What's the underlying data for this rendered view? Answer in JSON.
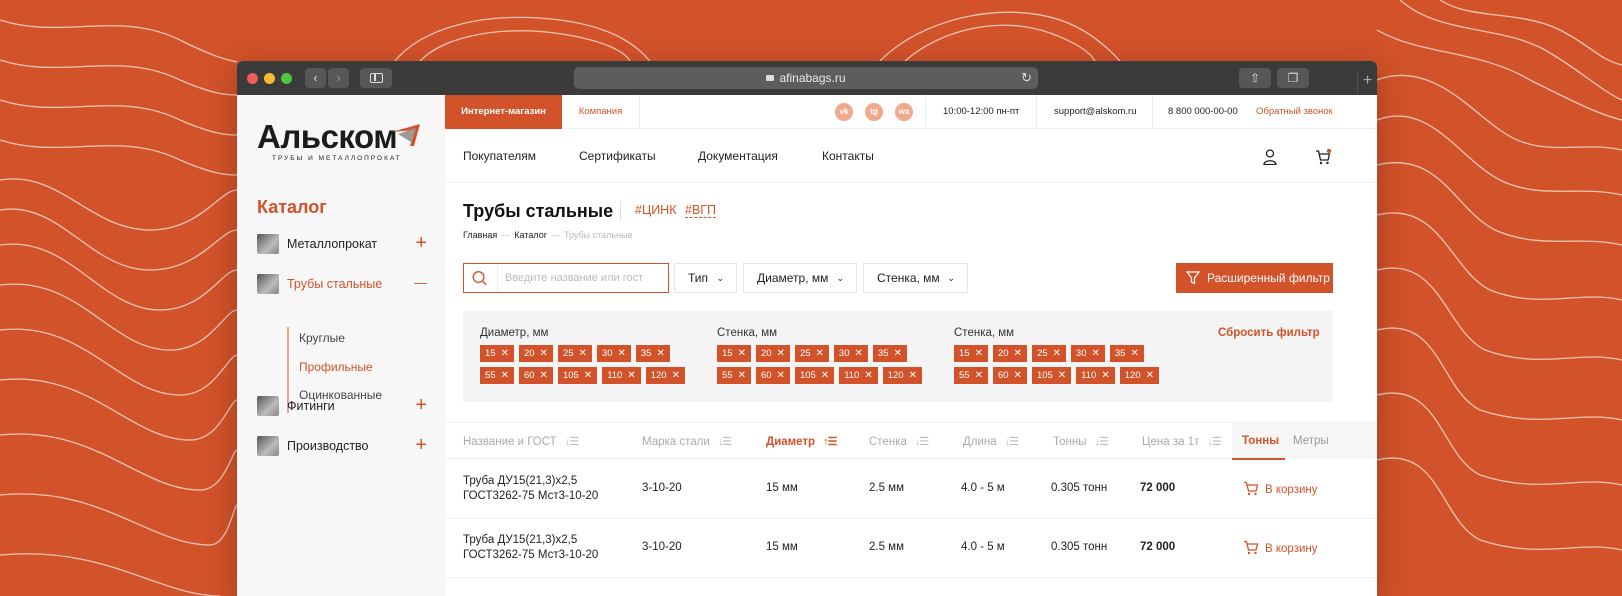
{
  "browser": {
    "url": "afinabags.ru",
    "back_label": "‹",
    "forward_label": "›"
  },
  "logo": {
    "name": "Альском",
    "tagline": "ТРУБЫ И МЕТАЛЛОПРОКАТ"
  },
  "sidebar": {
    "catalog_title": "Каталог",
    "items": [
      {
        "label": "Металлопрокат",
        "toggle": "+"
      },
      {
        "label": "Трубы стальные",
        "toggle": "—"
      },
      {
        "label": "Фитинги",
        "toggle": "+"
      },
      {
        "label": "Производство",
        "toggle": "+"
      }
    ],
    "sub_items": [
      "Круглые",
      "Профильные",
      "Оцинкованные"
    ]
  },
  "topbar": {
    "tab_shop": "Интернет-магазин",
    "tab_company": "Компания",
    "social": [
      "vk",
      "tg",
      "wa"
    ],
    "hours": "10:00-12:00 пн-пт",
    "email": "support@alskom.ru",
    "phone": "8 800 000-00-00",
    "callback": "Обратный звонок"
  },
  "nav": [
    "Покупателям",
    "Сертификаты",
    "Документация",
    "Контакты"
  ],
  "page": {
    "title": "Трубы стальные",
    "tags": [
      "#ЦИНК",
      "#ВГП"
    ],
    "breadcrumb": [
      "Главная",
      "Каталог",
      "Трубы стальные"
    ],
    "breadcrumb_sep": "—"
  },
  "filters_bar": {
    "search_placeholder": "Введите название или гост",
    "dropdowns": [
      "Тип",
      "Диаметр, мм",
      "Стенка, мм"
    ],
    "advanced": "Расширенный фильтр"
  },
  "active_filters": {
    "groups": [
      {
        "title": "Диаметр, мм",
        "row1": [
          "15",
          "20",
          "25",
          "30",
          "35"
        ],
        "row2": [
          "55",
          "60",
          "105",
          "110",
          "120"
        ]
      },
      {
        "title": "Стенка, мм",
        "row1": [
          "15",
          "20",
          "25",
          "30",
          "35"
        ],
        "row2": [
          "55",
          "60",
          "105",
          "110",
          "120"
        ]
      },
      {
        "title": "Стенка, мм",
        "row1": [
          "15",
          "20",
          "25",
          "30",
          "35"
        ],
        "row2": [
          "55",
          "60",
          "105",
          "110",
          "120"
        ]
      }
    ],
    "reset": "Сбросить фильтр"
  },
  "table": {
    "headers": [
      "Название и ГОСТ",
      "Марка стали",
      "Диаметр",
      "Стенка",
      "Длина",
      "Тонны",
      "Цена за 1т"
    ],
    "active_sort": "Диаметр",
    "units": [
      "Тонны",
      "Метры"
    ],
    "rows": [
      {
        "name1": "Труба ДУ15(21,3)х2,5",
        "name2": "ГОСТ3262-75 Мст3-10-20",
        "steel": "3-10-20",
        "diameter": "15 мм",
        "wall": "2.5 мм",
        "length": "4.0 - 5 м",
        "tons": "0.305 тонн",
        "price": "72 000",
        "cart": "В корзину"
      },
      {
        "name1": "Труба ДУ15(21,3)х2,5",
        "name2": "ГОСТ3262-75 Мст3-10-20",
        "steel": "3-10-20",
        "diameter": "15 мм",
        "wall": "2.5 мм",
        "length": "4.0 - 5 м",
        "tons": "0.305 тонн",
        "price": "72 000",
        "cart": "В корзину"
      }
    ]
  },
  "colors": {
    "accent": "#d2522a",
    "accent_light": "#f1a98e"
  }
}
